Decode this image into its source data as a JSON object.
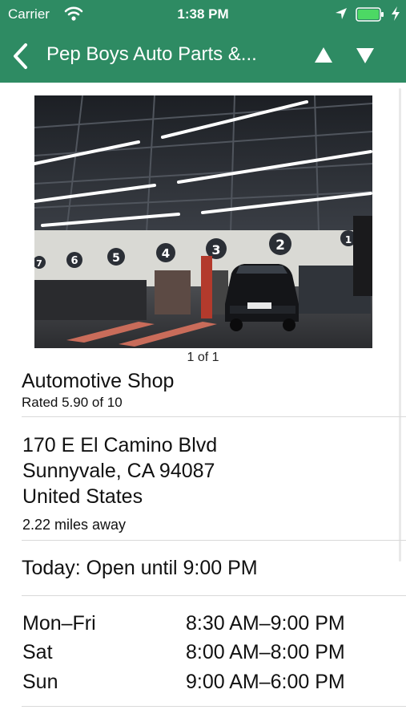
{
  "status": {
    "carrier": "Carrier",
    "time": "1:38 PM"
  },
  "nav": {
    "title": "Pep Boys Auto Parts &..."
  },
  "gallery": {
    "page_indicator": "1 of 1"
  },
  "place": {
    "category": "Automotive Shop",
    "rating": "Rated 5.90 of 10",
    "address": [
      "170 E El Camino Blvd",
      "Sunnyvale, CA 94087",
      "United States"
    ],
    "distance": "2.22 miles away",
    "today": "Today: Open until 9:00 PM",
    "hours": [
      {
        "day": "Mon–Fri",
        "time": "8:30 AM–9:00 PM"
      },
      {
        "day": "Sat",
        "time": "8:00 AM–8:00 PM"
      },
      {
        "day": "Sun",
        "time": "9:00 AM–6:00 PM"
      }
    ]
  },
  "colors": {
    "nav_green": "#2e8b63",
    "separator": "#d9d9d9",
    "battery_green": "#4cd964"
  },
  "photo_bay_numbers": [
    "7",
    "6",
    "5",
    "4",
    "3",
    "2",
    "1"
  ]
}
